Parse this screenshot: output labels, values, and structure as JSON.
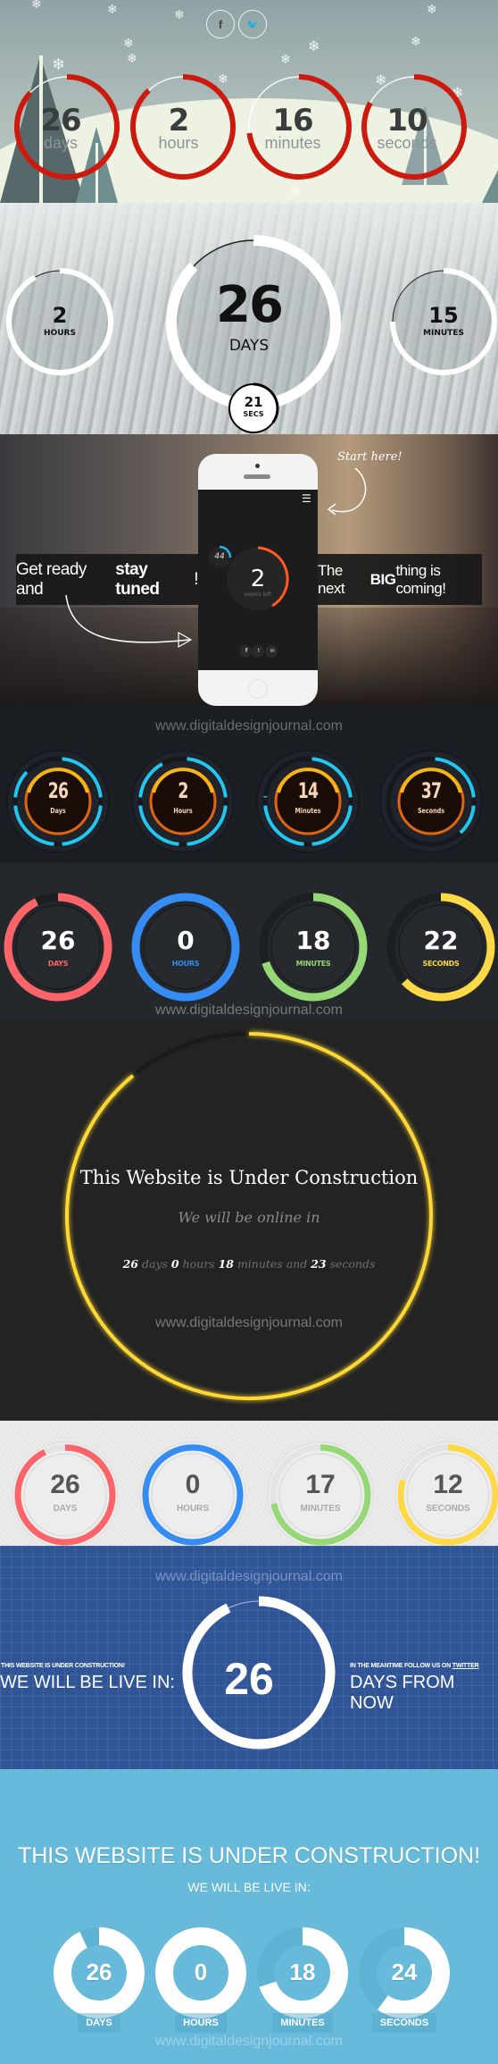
{
  "winter": {
    "social": [
      {
        "icon": "facebook-icon",
        "glyph": "f"
      },
      {
        "icon": "twitter-icon",
        "glyph": "🐦"
      }
    ],
    "units": [
      {
        "value": "26",
        "label": "days",
        "progress": 0.87
      },
      {
        "value": "2",
        "label": "hours",
        "progress": 0.88
      },
      {
        "value": "16",
        "label": "minutes",
        "progress": 0.73
      },
      {
        "value": "10",
        "label": "seconds",
        "progress": 0.83
      }
    ],
    "ring_color": "#cc1a0e"
  },
  "forest": {
    "days": {
      "value": "26",
      "label": "DAYS",
      "progress": 0.87
    },
    "hours": {
      "value": "2",
      "label": "HOURS",
      "progress": 0.92
    },
    "minutes": {
      "value": "15",
      "label": "MINUTES",
      "progress": 0.75
    },
    "seconds": {
      "value": "21",
      "label": "SECS",
      "progress": 0.35
    }
  },
  "city": {
    "left_banner": {
      "text": "Get ready and ",
      "bold": "stay tuned",
      "end": "!"
    },
    "right_banner": {
      "text": "The next ",
      "bold": "BIG",
      "end": " thing is coming!"
    },
    "start_here": "Start here!",
    "phone": {
      "small_value": "44",
      "big_value": "2",
      "big_label": "weeks left"
    },
    "phone_social": [
      "facebook-icon",
      "twitter-icon",
      "email-icon"
    ]
  },
  "glow": {
    "url": "www.digitaldesignjournal.com",
    "units": [
      {
        "value": "26",
        "label": "Days",
        "progress": 0.87
      },
      {
        "value": "2",
        "label": "Hours",
        "progress": 0.92
      },
      {
        "value": "14",
        "label": "Minutes",
        "progress": 0.77
      },
      {
        "value": "37",
        "label": "Seconds",
        "progress": 0.38
      }
    ],
    "accent": "#22c7f0"
  },
  "colored": {
    "url": "www.digitaldesignjournal.com",
    "units": [
      {
        "value": "26",
        "label": "DAYS",
        "progress": 0.93,
        "color": "#fb6468"
      },
      {
        "value": "0",
        "label": "HOURS",
        "progress": 1.0,
        "color": "#358df3"
      },
      {
        "value": "18",
        "label": "MINUTES",
        "progress": 0.7,
        "color": "#96d776"
      },
      {
        "value": "22",
        "label": "SECONDS",
        "progress": 0.63,
        "color": "#fdd847"
      }
    ]
  },
  "yellow": {
    "title": "This Website is Under Construction",
    "subtitle": "We will be online in",
    "countdown": [
      {
        "value": "26",
        "unit": " days "
      },
      {
        "value": "0",
        "unit": " hours "
      },
      {
        "value": "18",
        "unit": " minutes and "
      },
      {
        "value": "23",
        "unit": " seconds"
      }
    ],
    "url": "www.digitaldesignjournal.com",
    "progress": 0.89,
    "color": "#fdd835"
  },
  "gray": {
    "units": [
      {
        "value": "26",
        "label": "DAYS",
        "progress": 0.93,
        "color": "#fb6468"
      },
      {
        "value": "0",
        "label": "HOURS",
        "progress": 1.0,
        "color": "#358df3"
      },
      {
        "value": "17",
        "label": "MINUTES",
        "progress": 0.72,
        "color": "#96d776"
      },
      {
        "value": "12",
        "label": "SECONDS",
        "progress": 0.8,
        "color": "#fdd847"
      }
    ]
  },
  "blueprint": {
    "url": "www.digitaldesignjournal.com",
    "left_small": "THIS WEBSITE IS UNDER CONSTRUCTION!",
    "left_big": "WE WILL BE LIVE IN:",
    "right_small": "IN THE MEANTIME FOLLOW US ON ",
    "right_link": "TWITTER",
    "right_big": "DAYS FROM NOW",
    "value": "26",
    "progress": 0.93
  },
  "lightblue": {
    "title": "THIS WEBSITE IS UNDER CONSTRUCTION!",
    "subtitle": "WE WILL BE LIVE IN:",
    "units": [
      {
        "value": "26",
        "label": "DAYS",
        "progress": 0.93
      },
      {
        "value": "0",
        "label": "HOURS",
        "progress": 1.0
      },
      {
        "value": "18",
        "label": "MINUTES",
        "progress": 0.7
      },
      {
        "value": "24",
        "label": "SECONDS",
        "progress": 0.6
      }
    ],
    "url": "www.digitaldesignjournal.com"
  }
}
